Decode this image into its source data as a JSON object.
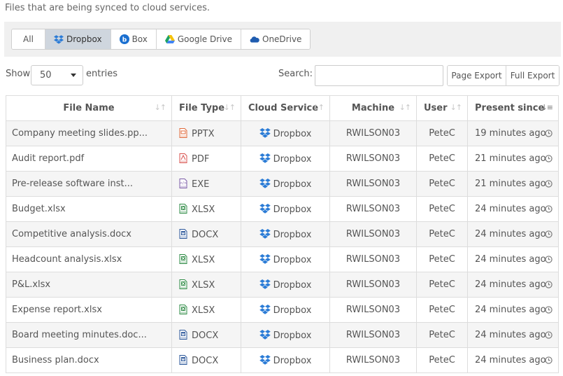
{
  "subtitle": "Files that are being synced to cloud services.",
  "filters": {
    "all": "All",
    "dropbox": "Dropbox",
    "box": "Box",
    "google_drive": "Google Drive",
    "onedrive": "OneDrive",
    "active": "dropbox"
  },
  "length": {
    "show": "Show",
    "value": "50",
    "entries": "entries"
  },
  "search": {
    "label": "Search:",
    "value": "",
    "placeholder": ""
  },
  "export": {
    "page": "Page Export",
    "full": "Full Export"
  },
  "columns": [
    "File Name",
    "File Type",
    "Cloud Service",
    "Machine",
    "User",
    "Present since"
  ],
  "sorted_column": "Present since",
  "rows": [
    {
      "file_name": "Company meeting slides.pp...",
      "file_type": "PPTX",
      "type_icon": "powerpoint-file-icon",
      "cloud_service": "Dropbox",
      "machine": "RWILSON03",
      "user": "PeteC",
      "present_since": "19 minutes ago"
    },
    {
      "file_name": "Audit report.pdf",
      "file_type": "PDF",
      "type_icon": "pdf-file-icon",
      "cloud_service": "Dropbox",
      "machine": "RWILSON03",
      "user": "PeteC",
      "present_since": "21 minutes ago"
    },
    {
      "file_name": "Pre-release software inst...",
      "file_type": "EXE",
      "type_icon": "executable-file-icon",
      "cloud_service": "Dropbox",
      "machine": "RWILSON03",
      "user": "PeteC",
      "present_since": "21 minutes ago"
    },
    {
      "file_name": "Budget.xlsx",
      "file_type": "XLSX",
      "type_icon": "excel-file-icon",
      "cloud_service": "Dropbox",
      "machine": "RWILSON03",
      "user": "PeteC",
      "present_since": "24 minutes ago"
    },
    {
      "file_name": "Competitive analysis.docx",
      "file_type": "DOCX",
      "type_icon": "word-file-icon",
      "cloud_service": "Dropbox",
      "machine": "RWILSON03",
      "user": "PeteC",
      "present_since": "24 minutes ago"
    },
    {
      "file_name": "Headcount analysis.xlsx",
      "file_type": "XLSX",
      "type_icon": "excel-file-icon",
      "cloud_service": "Dropbox",
      "machine": "RWILSON03",
      "user": "PeteC",
      "present_since": "24 minutes ago"
    },
    {
      "file_name": "P&L.xlsx",
      "file_type": "XLSX",
      "type_icon": "excel-file-icon",
      "cloud_service": "Dropbox",
      "machine": "RWILSON03",
      "user": "PeteC",
      "present_since": "24 minutes ago"
    },
    {
      "file_name": "Expense report.xlsx",
      "file_type": "XLSX",
      "type_icon": "excel-file-icon",
      "cloud_service": "Dropbox",
      "machine": "RWILSON03",
      "user": "PeteC",
      "present_since": "24 minutes ago"
    },
    {
      "file_name": "Board meeting minutes.doc...",
      "file_type": "DOCX",
      "type_icon": "word-file-icon",
      "cloud_service": "Dropbox",
      "machine": "RWILSON03",
      "user": "PeteC",
      "present_since": "24 minutes ago"
    },
    {
      "file_name": "Business plan.docx",
      "file_type": "DOCX",
      "type_icon": "word-file-icon",
      "cloud_service": "Dropbox",
      "machine": "RWILSON03",
      "user": "PeteC",
      "present_since": "24 minutes ago"
    }
  ],
  "colors": {
    "dropbox": "#2a7bd6",
    "box": "#1a6fd0",
    "onedrive": "#1f5cb0",
    "excel": "#2e8b45",
    "word": "#2b579a",
    "powerpoint": "#e06a3b",
    "pdf": "#d9534f",
    "exe": "#7a5aa6",
    "active_filter": "#cfd6de",
    "striped_row": "#f5f5f5"
  }
}
